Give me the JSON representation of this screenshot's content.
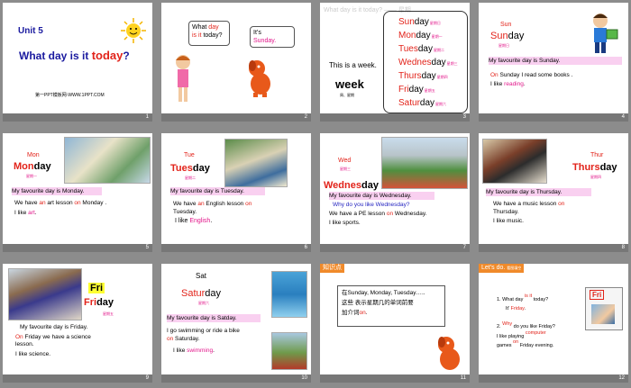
{
  "slides": [
    {
      "number": "1",
      "unit": "Unit 5",
      "title_prefix": "What day is it ",
      "title_highlight": "today",
      "title_suffix": "?",
      "footer": "第一PPT模板网-WWW.1PPT.COM"
    },
    {
      "number": "2",
      "bubble1_a": "What ",
      "bubble1_b": "day",
      "bubble1_c": "is it ",
      "bubble1_d": "today?",
      "bubble2_a": "It’s",
      "bubble2_b": "Sunday."
    },
    {
      "number": "3",
      "top_text": "What day is it today? —— 星期",
      "intro": "This is a week.",
      "week": "week",
      "week_cn": "周、星期",
      "days": [
        {
          "red": "Sun",
          "rest": "day",
          "cn": "星期日"
        },
        {
          "red": "Mon",
          "rest": "day",
          "cn": "星期一"
        },
        {
          "red": "Tues",
          "rest": "day",
          "cn": "星期二"
        },
        {
          "red": "Wednes",
          "rest": "day",
          "cn": "星期三"
        },
        {
          "red": "Thurs",
          "rest": "day",
          "cn": "星期四"
        },
        {
          "red": "Fri",
          "rest": "day",
          "cn": "星期五"
        },
        {
          "red": "Satur",
          "rest": "day",
          "cn": "星期六"
        }
      ]
    },
    {
      "number": "4",
      "abbr": "Sun",
      "day_red": "Sun",
      "day_rest": "day",
      "cn": "星期日",
      "fav": "My favourite day is Sunday.",
      "l1_a": "On",
      "l1_b": " Sunday I read some books .",
      "l2_a": "I like ",
      "l2_b": "reading",
      "l2_c": "."
    },
    {
      "number": "5",
      "abbr": "Mon",
      "day_red": "Mon",
      "day_rest": "day",
      "cn": "星期一",
      "fav": "My favourite day is Monday.",
      "l1_a": "We have ",
      "l1_b": "an",
      "l1_c": " art lesson ",
      "l1_d": "on",
      "l1_e": " Monday .",
      "l2_a": "I like ",
      "l2_b": "art",
      "l2_c": "."
    },
    {
      "number": "6",
      "abbr": "Tue",
      "day_red": "Tues",
      "day_rest": "day",
      "cn": "星期二",
      "fav": "My favourite day is Tuesday.",
      "l1_a": "We have ",
      "l1_b": "an",
      "l1_c": " English lesson ",
      "l1_d": "on",
      "l1_e": "Tuesday.",
      "l2_a": "I like ",
      "l2_b": "English",
      "l2_c": "."
    },
    {
      "number": "7",
      "abbr": "Wed",
      "day_red": "Wednes",
      "day_rest": "day",
      "cn": "星期三",
      "fav": "My favourite day is Wednesday.",
      "question": "Why do you  like Wednesday?",
      "l1_a": "We have a PE lesson ",
      "l1_b": "on",
      "l1_c": " Wednesday.",
      "l2": "I like sports."
    },
    {
      "number": "8",
      "abbr": "Thur",
      "day_red": "Thurs",
      "day_rest": "day",
      "cn": "星期四",
      "fav": "My favourite day is Thursday.",
      "l1_a": "We have a music lesson ",
      "l1_b": "on",
      "l1_c": "Thursday.",
      "l2": "I like music."
    },
    {
      "number": "9",
      "abbr": "Fri",
      "day_red": "Fri",
      "day_rest": "day",
      "cn": "星期五",
      "fav": "My favourite day is Friday.",
      "l1_a": "On",
      "l1_b": " Friday we have a science lesson.",
      "l2": "I like science."
    },
    {
      "number": "10",
      "abbr": "Sat",
      "day_red": "Satur",
      "day_rest": "day",
      "cn": "星期六",
      "fav": "My favourite day is Satday.",
      "l1": "I go swimming or ride a bike",
      "l1_b": "on",
      "l1_c": " Saturday.",
      "l2_a": "I like ",
      "l2_b": "swimming",
      "l2_c": "."
    },
    {
      "number": "11",
      "label": "知识点",
      "box1": "在Sunday, Monday, Tuesday…..",
      "box2": "这些 表示星期几的单词前要",
      "box3_a": "加介词",
      "box3_b": "on",
      "box3_c": "."
    },
    {
      "number": "12",
      "label": "Let’s do.",
      "label_cn": "看图填空",
      "q1_a": "1. What day",
      "q1_blank": "is",
      "q1_mid": "it",
      "q1_end": "today?",
      "q1_l2_a": "It’",
      "q1_l2_b": "Friday",
      "q1_l2_c": ".",
      "q2_a": "2.",
      "q2_why": "Why",
      "q2_b": "do you like Friday?",
      "q2_l2_a": "I like playing",
      "q2_computer": "computer",
      "q2_l3_a": "games",
      "q2_on": "on",
      "q2_l3_b": "Friday evening.",
      "badge": "Fri"
    }
  ],
  "colors": {
    "title_blue": "#1a1a9f",
    "red": "#e2231a",
    "magenta": "#e2168a",
    "pink": "#f9d0f0",
    "band": "#777777",
    "grey": "#8c8c8c"
  }
}
